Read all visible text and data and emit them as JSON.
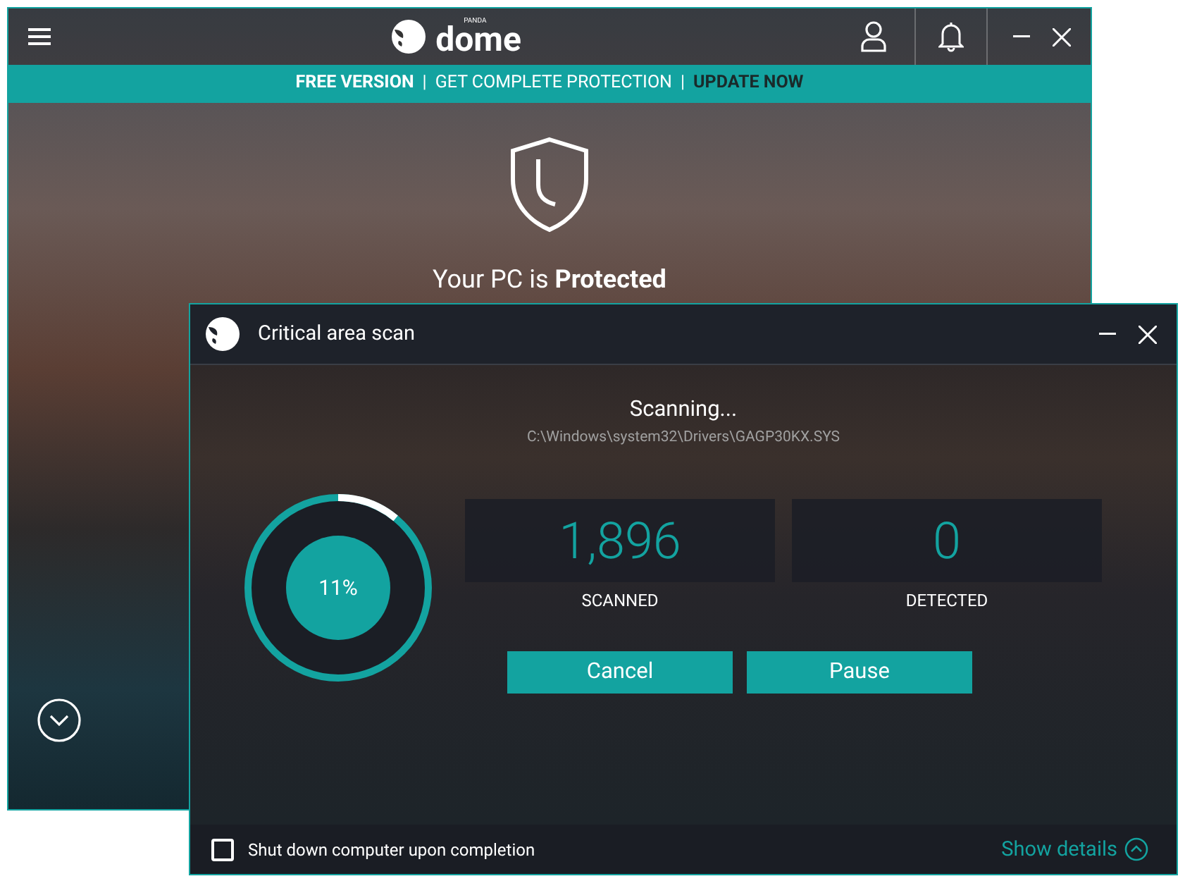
{
  "main_window": {
    "logo": {
      "small": "PANDA",
      "name": "dome"
    },
    "banner": [
      {
        "text": "FREE VERSION",
        "kind": "bold"
      },
      {
        "text": "|",
        "kind": "sep"
      },
      {
        "text": "GET COMPLETE PROTECTION",
        "kind": "plain"
      },
      {
        "text": "|",
        "kind": "sep"
      },
      {
        "text": "UPDATE NOW",
        "kind": "link"
      }
    ],
    "status": "Your PC is **Protected**"
  },
  "scan_dialog": {
    "title": "Critical area scan",
    "heading": "Scanning...",
    "path": "C:\\Windows\\system32\\Drivers\\GAGP30KX.SYS",
    "progress": {
      "level": 0.11,
      "reading": "11%"
    },
    "stats": [
      {
        "value": "1,896",
        "label": "SCANNED"
      },
      {
        "value": "0",
        "label": "DETECTED"
      }
    ],
    "buttons": [
      "Cancel",
      "Pause"
    ],
    "shutdown": {
      "label": "Shut down computer upon completion",
      "checked": false
    },
    "details_link": "Show details"
  }
}
